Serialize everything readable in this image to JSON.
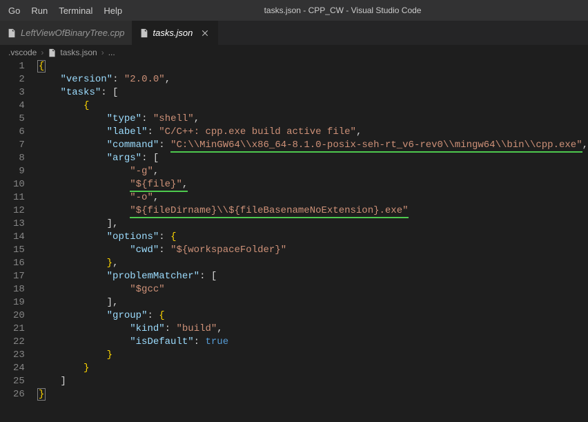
{
  "menubar": {
    "items": [
      {
        "label": "Go"
      },
      {
        "label": "Run"
      },
      {
        "label": "Terminal"
      },
      {
        "label": "Help"
      }
    ]
  },
  "window_title": "tasks.json - CPP_CW - Visual Studio Code",
  "tabs": [
    {
      "name": "LeftViewOfBinaryTree.cpp",
      "active": false,
      "closeVisible": false
    },
    {
      "name": "tasks.json",
      "active": true,
      "closeVisible": true
    }
  ],
  "breadcrumb": {
    "parts": [
      {
        "label": ".vscode"
      },
      {
        "label": "tasks.json"
      },
      {
        "label": "..."
      }
    ]
  },
  "code": {
    "lines": [
      [
        {
          "t": "brace",
          "v": "{"
        }
      ],
      [
        {
          "t": "ws",
          "v": "    "
        },
        {
          "t": "key",
          "v": "\"version\""
        },
        {
          "t": "punc",
          "v": ": "
        },
        {
          "t": "str",
          "v": "\"2.0.0\""
        },
        {
          "t": "punc",
          "v": ","
        }
      ],
      [
        {
          "t": "ws",
          "v": "    "
        },
        {
          "t": "key",
          "v": "\"tasks\""
        },
        {
          "t": "punc",
          "v": ": ["
        }
      ],
      [
        {
          "t": "ws",
          "v": "        "
        },
        {
          "t": "brace",
          "v": "{"
        }
      ],
      [
        {
          "t": "ws",
          "v": "            "
        },
        {
          "t": "key",
          "v": "\"type\""
        },
        {
          "t": "punc",
          "v": ": "
        },
        {
          "t": "str",
          "v": "\"shell\""
        },
        {
          "t": "punc",
          "v": ","
        }
      ],
      [
        {
          "t": "ws",
          "v": "            "
        },
        {
          "t": "key",
          "v": "\"label\""
        },
        {
          "t": "punc",
          "v": ": "
        },
        {
          "t": "str",
          "v": "\"C/C++: cpp.exe build active file\""
        },
        {
          "t": "punc",
          "v": ","
        }
      ],
      [
        {
          "t": "ws",
          "v": "            "
        },
        {
          "t": "key",
          "v": "\"command\""
        },
        {
          "t": "punc",
          "v": ": "
        },
        {
          "t": "str",
          "ul": true,
          "v": "\"C:\\\\MinGW64\\\\x86_64-8.1.0-posix-seh-rt_v6-rev0\\\\mingw64\\\\bin\\\\cpp.exe\""
        },
        {
          "t": "punc",
          "v": ","
        }
      ],
      [
        {
          "t": "ws",
          "v": "            "
        },
        {
          "t": "key",
          "v": "\"args\""
        },
        {
          "t": "punc",
          "v": ": ["
        }
      ],
      [
        {
          "t": "ws",
          "v": "                "
        },
        {
          "t": "str",
          "v": "\"-g\""
        },
        {
          "t": "punc",
          "v": ","
        }
      ],
      [
        {
          "t": "ws",
          "v": "                "
        },
        {
          "t": "str",
          "ul": true,
          "v": "\"${file}\""
        },
        {
          "t": "punc",
          "ul": true,
          "v": ","
        }
      ],
      [
        {
          "t": "ws",
          "v": "                "
        },
        {
          "t": "str",
          "v": "\"-o\""
        },
        {
          "t": "punc",
          "v": ","
        }
      ],
      [
        {
          "t": "ws",
          "v": "                "
        },
        {
          "t": "str",
          "ul": true,
          "v": "\"${fileDirname}\\\\${fileBasenameNoExtension}.exe\""
        }
      ],
      [
        {
          "t": "ws",
          "v": "            "
        },
        {
          "t": "punc",
          "v": "],"
        }
      ],
      [
        {
          "t": "ws",
          "v": "            "
        },
        {
          "t": "key",
          "v": "\"options\""
        },
        {
          "t": "punc",
          "v": ": "
        },
        {
          "t": "brace",
          "v": "{"
        }
      ],
      [
        {
          "t": "ws",
          "v": "                "
        },
        {
          "t": "key",
          "v": "\"cwd\""
        },
        {
          "t": "punc",
          "v": ": "
        },
        {
          "t": "str",
          "v": "\"${workspaceFolder}\""
        }
      ],
      [
        {
          "t": "ws",
          "v": "            "
        },
        {
          "t": "brace",
          "v": "}"
        },
        {
          "t": "punc",
          "v": ","
        }
      ],
      [
        {
          "t": "ws",
          "v": "            "
        },
        {
          "t": "key",
          "v": "\"problemMatcher\""
        },
        {
          "t": "punc",
          "v": ": ["
        }
      ],
      [
        {
          "t": "ws",
          "v": "                "
        },
        {
          "t": "str",
          "v": "\"$gcc\""
        }
      ],
      [
        {
          "t": "ws",
          "v": "            "
        },
        {
          "t": "punc",
          "v": "],"
        }
      ],
      [
        {
          "t": "ws",
          "v": "            "
        },
        {
          "t": "key",
          "v": "\"group\""
        },
        {
          "t": "punc",
          "v": ": "
        },
        {
          "t": "brace",
          "v": "{"
        }
      ],
      [
        {
          "t": "ws",
          "v": "                "
        },
        {
          "t": "key",
          "v": "\"kind\""
        },
        {
          "t": "punc",
          "v": ": "
        },
        {
          "t": "str",
          "v": "\"build\""
        },
        {
          "t": "punc",
          "v": ","
        }
      ],
      [
        {
          "t": "ws",
          "v": "                "
        },
        {
          "t": "key",
          "v": "\"isDefault\""
        },
        {
          "t": "punc",
          "v": ": "
        },
        {
          "t": "lit",
          "v": "true"
        }
      ],
      [
        {
          "t": "ws",
          "v": "            "
        },
        {
          "t": "brace",
          "v": "}"
        }
      ],
      [
        {
          "t": "ws",
          "v": "        "
        },
        {
          "t": "brace",
          "v": "}"
        }
      ],
      [
        {
          "t": "ws",
          "v": "    "
        },
        {
          "t": "punc",
          "v": "]"
        }
      ],
      [
        {
          "t": "brace",
          "v": "}"
        }
      ]
    ]
  }
}
